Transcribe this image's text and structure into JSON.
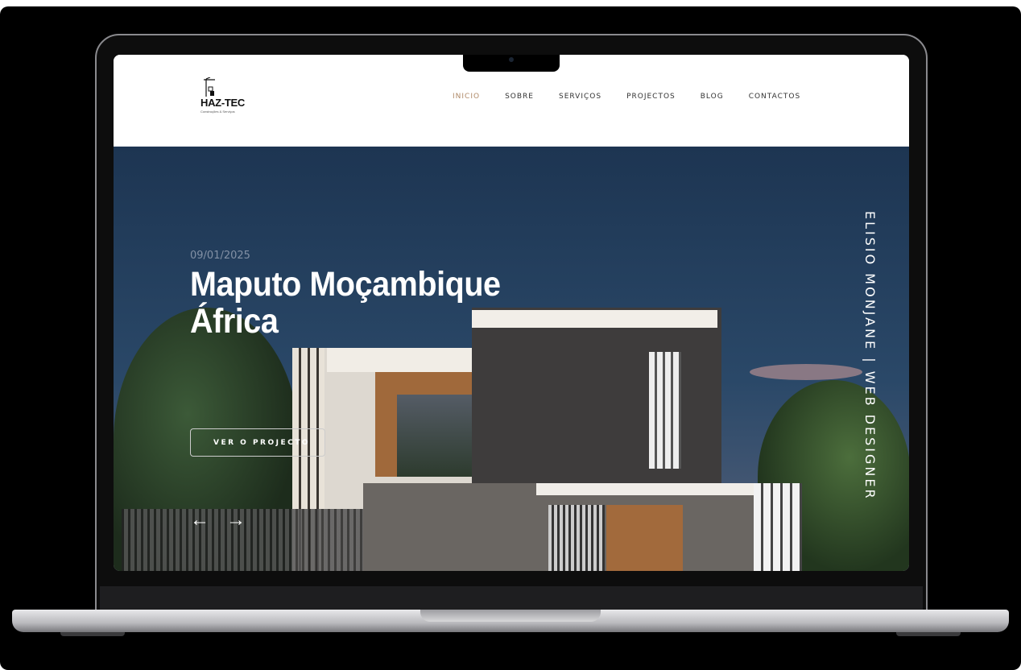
{
  "site": {
    "logo_text": "HAZ-TEC",
    "logo_subtitle": "Construções & Serviços"
  },
  "nav": {
    "items": [
      {
        "label": "INICIO",
        "active": true
      },
      {
        "label": "SOBRE"
      },
      {
        "label": "SERVIÇOS"
      },
      {
        "label": "PROJECTOS"
      },
      {
        "label": "BLOG"
      },
      {
        "label": "CONTACTOS"
      }
    ]
  },
  "hero": {
    "date": "09/01/2025",
    "title_line1": "Maputo Moçambique",
    "title_line2": "África",
    "button": "VER O PROJECTO",
    "prev_arrow": "←",
    "next_arrow": "→",
    "vertical_text": "ELISIO MONJANE | WEB DESIGNER"
  },
  "colors": {
    "accent": "#b08a68",
    "sky": "#2a4868"
  }
}
